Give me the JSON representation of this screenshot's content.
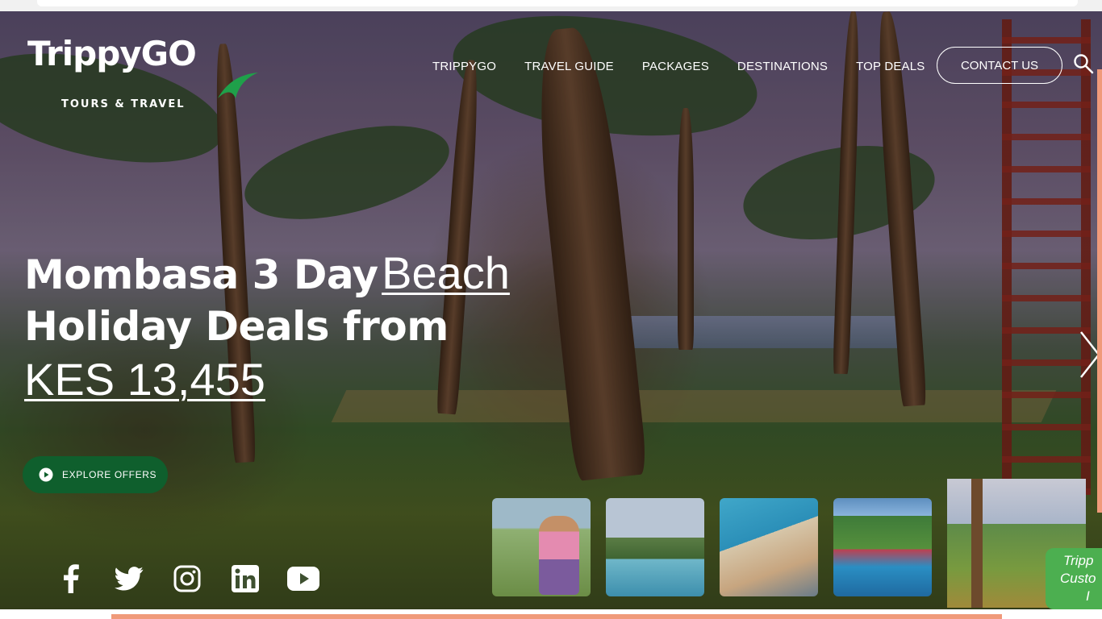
{
  "brand": {
    "name": "TrippyGO",
    "tagline": "TOURS & TRAVEL",
    "accent_color": "#0f5f2d",
    "leaf_color": "#1fa04a"
  },
  "nav": {
    "items": [
      {
        "label": "TRIPPYGO"
      },
      {
        "label": "TRAVEL GUIDE"
      },
      {
        "label": "PACKAGES"
      },
      {
        "label": "DESTINATIONS"
      },
      {
        "label": "TOP DEALS"
      }
    ],
    "contact_label": "CONTACT US",
    "search_icon": "search-icon"
  },
  "hero": {
    "headline_part1": "Mombasa 3 Day",
    "headline_link1": "Beach",
    "headline_part2": "Holiday Deals from",
    "headline_link2": "KES 13,455",
    "cta_label": "EXPLORE OFFERS",
    "cta_icon": "play-circle-icon"
  },
  "socials": [
    {
      "icon": "facebook-icon"
    },
    {
      "icon": "twitter-icon"
    },
    {
      "icon": "instagram-icon"
    },
    {
      "icon": "linkedin-icon"
    },
    {
      "icon": "youtube-icon"
    }
  ],
  "thumbnails": [
    {
      "icon": "thumbnail-traveler"
    },
    {
      "icon": "thumbnail-pool"
    },
    {
      "icon": "thumbnail-poolside"
    },
    {
      "icon": "thumbnail-resort"
    },
    {
      "icon": "thumbnail-beach-garden"
    }
  ],
  "carousel": {
    "next_icon": "chevron-right-icon"
  },
  "chat_badge": {
    "lines": [
      "Tripp",
      "Custo",
      "I"
    ],
    "color": "#4caf50"
  },
  "accent_color": "#f09a7a"
}
